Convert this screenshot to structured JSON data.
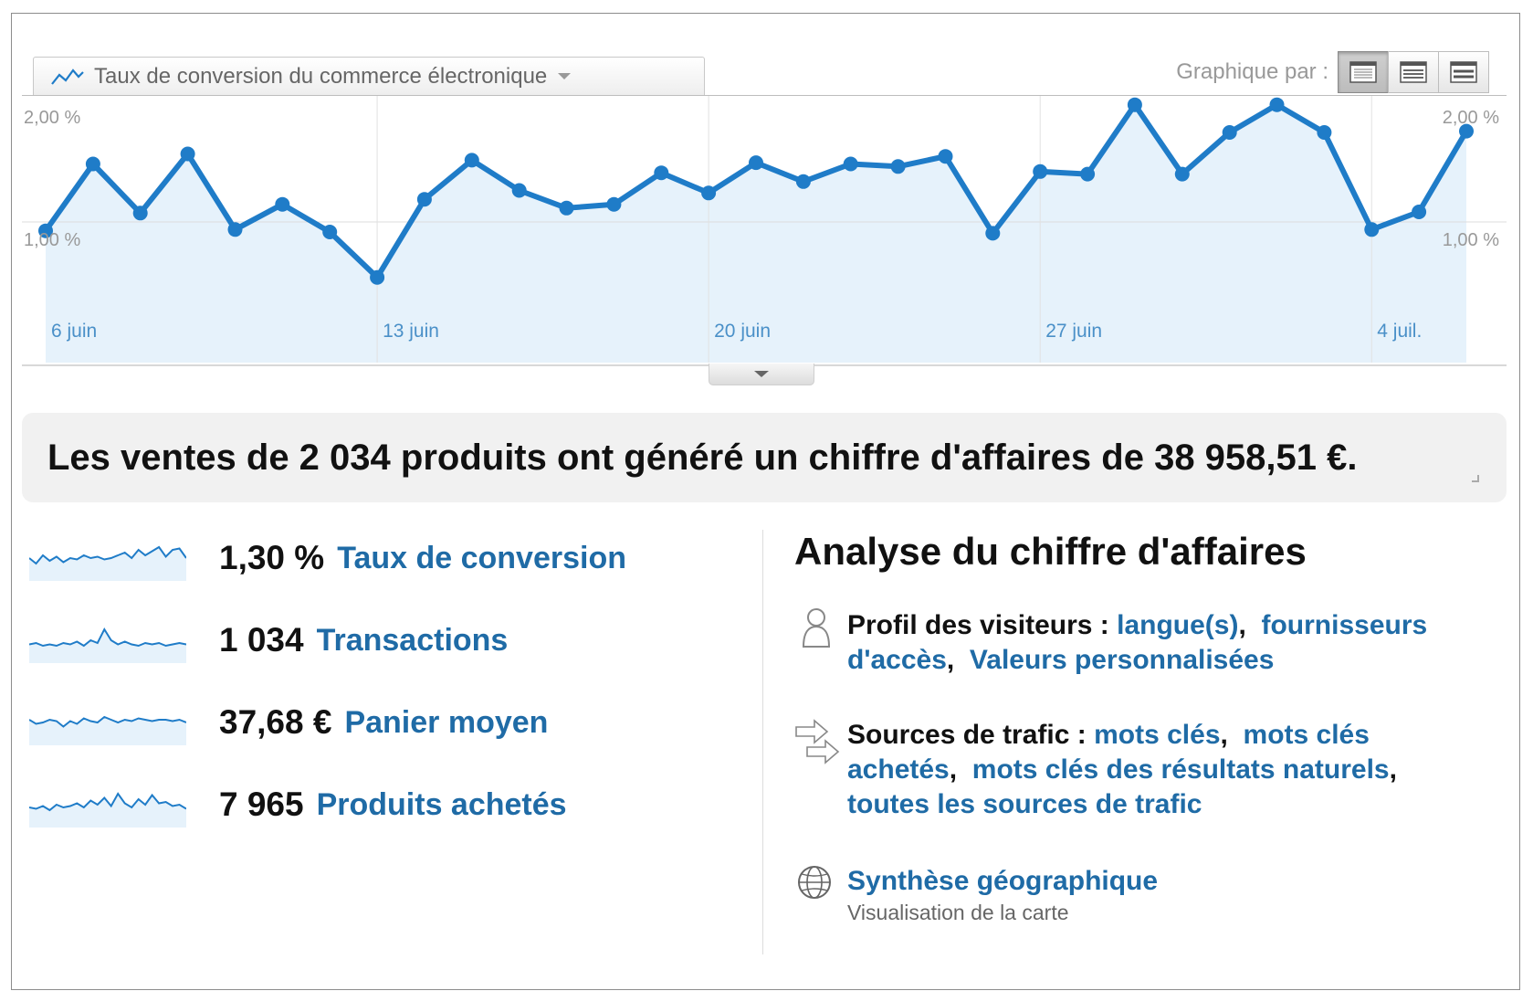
{
  "metric_selector": {
    "label": "Taux de conversion du commerce électronique",
    "icon": "line-chart-icon"
  },
  "graph_by": {
    "label": "Graphique par :",
    "options": [
      "day-view-icon",
      "week-view-icon",
      "month-view-icon"
    ],
    "selected": 0
  },
  "colors": {
    "accent": "#1f7cc8",
    "fill": "#e6f2fb",
    "link": "#1f6ba6"
  },
  "chart_data": {
    "type": "line",
    "ylim": [
      0,
      2.0
    ],
    "y_ticks": [
      {
        "value": 2.0,
        "label": "2,00 %"
      },
      {
        "value": 1.0,
        "label": "1,00 %"
      }
    ],
    "x_labels": [
      {
        "index": 0,
        "label": "6 juin"
      },
      {
        "index": 7,
        "label": "13 juin"
      },
      {
        "index": 14,
        "label": "20 juin"
      },
      {
        "index": 21,
        "label": "27 juin"
      },
      {
        "index": 28,
        "label": "4 juil."
      }
    ],
    "series": [
      {
        "values": [
          0.93,
          1.46,
          1.07,
          1.54,
          0.94,
          1.14,
          0.92,
          0.56,
          1.18,
          1.49,
          1.25,
          1.11,
          1.14,
          1.39,
          1.23,
          1.47,
          1.32,
          1.46,
          1.44,
          1.52,
          0.91,
          1.4,
          1.38,
          1.93,
          1.38,
          1.71,
          1.93,
          1.71,
          0.94,
          1.08,
          1.72
        ]
      }
    ],
    "grid": true
  },
  "summary": {
    "text": "Les ventes de 2 034 produits ont généré un chiffre d'affaires de 38 958,51 €."
  },
  "metrics": [
    {
      "value": "1,30 %",
      "label": "Taux de conversion",
      "spark": [
        0.5,
        0.3,
        0.6,
        0.4,
        0.55,
        0.35,
        0.5,
        0.45,
        0.6,
        0.5,
        0.55,
        0.45,
        0.5,
        0.6,
        0.7,
        0.5,
        0.8,
        0.6,
        0.75,
        0.9,
        0.55,
        0.8,
        0.85,
        0.5
      ]
    },
    {
      "value": "1 034",
      "label": "Transactions",
      "spark": [
        0.35,
        0.4,
        0.3,
        0.35,
        0.3,
        0.4,
        0.35,
        0.45,
        0.3,
        0.5,
        0.4,
        0.9,
        0.5,
        0.35,
        0.45,
        0.35,
        0.3,
        0.4,
        0.35,
        0.4,
        0.3,
        0.35,
        0.4,
        0.35
      ]
    },
    {
      "value": "37,68 €",
      "label": "Panier moyen",
      "spark": [
        0.6,
        0.45,
        0.5,
        0.6,
        0.55,
        0.35,
        0.55,
        0.45,
        0.65,
        0.55,
        0.5,
        0.7,
        0.6,
        0.5,
        0.6,
        0.55,
        0.65,
        0.6,
        0.55,
        0.6,
        0.6,
        0.55,
        0.6,
        0.5
      ]
    },
    {
      "value": "7 965",
      "label": "Produits achetés",
      "spark": [
        0.4,
        0.35,
        0.45,
        0.3,
        0.5,
        0.4,
        0.45,
        0.55,
        0.4,
        0.65,
        0.5,
        0.75,
        0.45,
        0.9,
        0.55,
        0.4,
        0.7,
        0.5,
        0.85,
        0.55,
        0.6,
        0.45,
        0.5,
        0.35
      ]
    }
  ],
  "analysis": {
    "title": "Analyse du chiffre d'affaires",
    "visitors": {
      "icon": "person-icon",
      "label": "Profil des visiteurs :",
      "links": [
        "langue(s)",
        "fournisseurs d'accès",
        "Valeurs personnalisées"
      ]
    },
    "traffic": {
      "icon": "arrows-icon",
      "label": "Sources de trafic :",
      "links": [
        "mots clés",
        "mots clés achetés",
        "mots clés des résultats naturels",
        "toutes les sources de trafic"
      ]
    },
    "geo": {
      "icon": "globe-icon",
      "link": "Synthèse géographique",
      "sub": "Visualisation de la carte"
    }
  }
}
